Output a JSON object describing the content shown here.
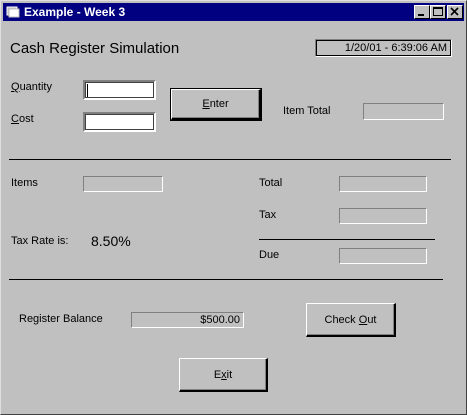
{
  "window": {
    "title": "Example - Week 3",
    "icon": "app-icon",
    "controls": [
      "minimize-icon",
      "maximize-icon",
      "close-icon"
    ]
  },
  "header": {
    "title": "Cash Register Simulation",
    "datetime": "1/20/01 - 6:39:06 AM"
  },
  "inputs": {
    "quantity_label_hotkey": "Q",
    "quantity_label_rest": "uantity",
    "quantity_value": "",
    "cost_label_hotkey": "C",
    "cost_label_rest": "ost",
    "cost_value": ""
  },
  "buttons": {
    "enter_hotkey": "E",
    "enter_rest": "nter",
    "checkout_pre": "Check ",
    "checkout_hotkey": "O",
    "checkout_rest": "ut",
    "exit_pre": "E",
    "exit_hotkey": "x",
    "exit_rest": "it"
  },
  "item_total": {
    "label": "Item Total",
    "value": ""
  },
  "summary": {
    "items_label": "Items",
    "items_value": "",
    "tax_rate_label": "Tax Rate is:",
    "tax_rate_value": "8.50%",
    "total_label": "Total",
    "total_value": "",
    "tax_label": "Tax",
    "tax_value": "",
    "due_label": "Due",
    "due_value": ""
  },
  "register": {
    "balance_label": "Register Balance",
    "balance_value": "$500.00"
  },
  "colors": {
    "face": "#c0c0c0",
    "titlebar": "#000080",
    "field": "#ffffff"
  }
}
